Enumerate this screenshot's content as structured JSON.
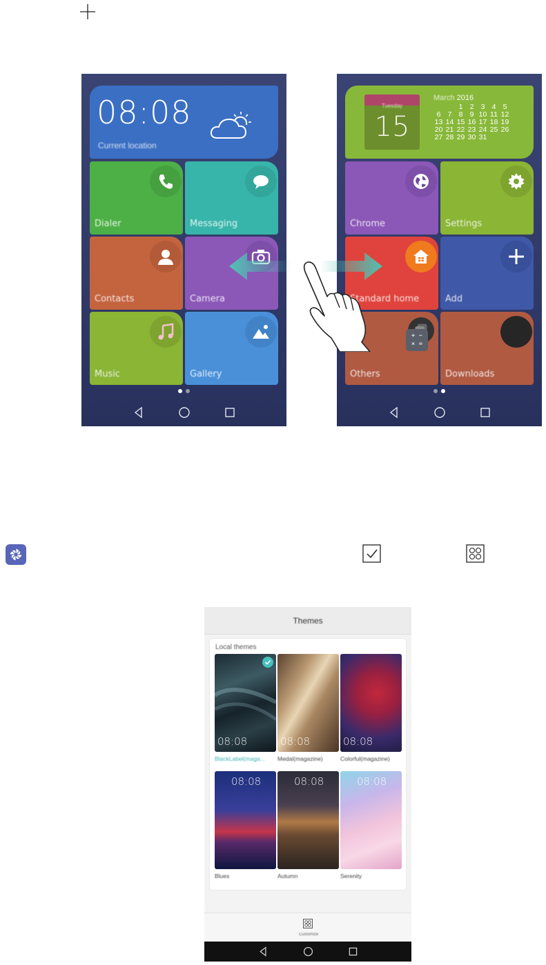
{
  "icons": {
    "add": "plus-icon",
    "theme_app": "themes-app-icon",
    "select": "checkbox-icon",
    "customize": "customize-grid-icon"
  },
  "left_screen": {
    "clock": {
      "time": "08:08",
      "location": "Current location"
    },
    "tiles": [
      {
        "label": "Dialer",
        "icon": "phone-icon",
        "color": "#4db046"
      },
      {
        "label": "Messaging",
        "icon": "chat-bubble-icon",
        "color": "#38b5ab"
      },
      {
        "label": "Contacts",
        "icon": "contact-icon",
        "color": "#c4643f"
      },
      {
        "label": "Camera",
        "icon": "camera-icon",
        "color": "#8b58b8"
      },
      {
        "label": "Music",
        "icon": "music-note-icon",
        "color": "#8ab535"
      },
      {
        "label": "Gallery",
        "icon": "gallery-icon",
        "color": "#4a90d9"
      }
    ],
    "page_indicator": {
      "pages": 2,
      "current": 1
    }
  },
  "right_screen": {
    "calendar": {
      "weekday": "Tuesday",
      "date": "15",
      "month": "March",
      "year": "2016",
      "weeks": [
        [
          "",
          "",
          "1",
          "2",
          "3",
          "4",
          "5"
        ],
        [
          "6",
          "7",
          "8",
          "9",
          "10",
          "11",
          "12"
        ],
        [
          "13",
          "14",
          "15",
          "16",
          "17",
          "18",
          "19"
        ],
        [
          "20",
          "21",
          "22",
          "23",
          "24",
          "25",
          "26"
        ],
        [
          "27",
          "28",
          "29",
          "30",
          "31",
          "",
          ""
        ]
      ]
    },
    "tiles": [
      {
        "label": "Chrome",
        "icon": "globe-icon",
        "color": "#8b58b8"
      },
      {
        "label": "Settings",
        "icon": "gear-icon",
        "color": "#8ab535"
      },
      {
        "label": "Standard home",
        "icon": "home-icon",
        "color": "#e0433d"
      },
      {
        "label": "Add",
        "icon": "plus-icon",
        "color": "#3f58a8"
      },
      {
        "label": "Others",
        "icon": "folder-icon",
        "color": "#b05a42"
      },
      {
        "label": "Downloads",
        "icon": "download-icon",
        "color": "#b05a42"
      }
    ],
    "page_indicator": {
      "pages": 2,
      "current": 2
    }
  },
  "gesture": {
    "icon": "swipe-hand-icon"
  },
  "themes": {
    "title": "Themes",
    "section_title": "Local themes",
    "items": [
      {
        "name": "BlackLabel(maga...",
        "time": "08:08",
        "selected": true
      },
      {
        "name": "Medal(magazine)",
        "time": "08:08",
        "selected": false
      },
      {
        "name": "Colorful(magazine)",
        "time": "08:08",
        "selected": false
      },
      {
        "name": "Blues",
        "time": "08:08",
        "selected": false
      },
      {
        "name": "Autumn",
        "time": "08:08",
        "selected": false
      },
      {
        "name": "Serenity",
        "time": "08:08",
        "selected": false
      }
    ],
    "customize_label": "Customize"
  }
}
